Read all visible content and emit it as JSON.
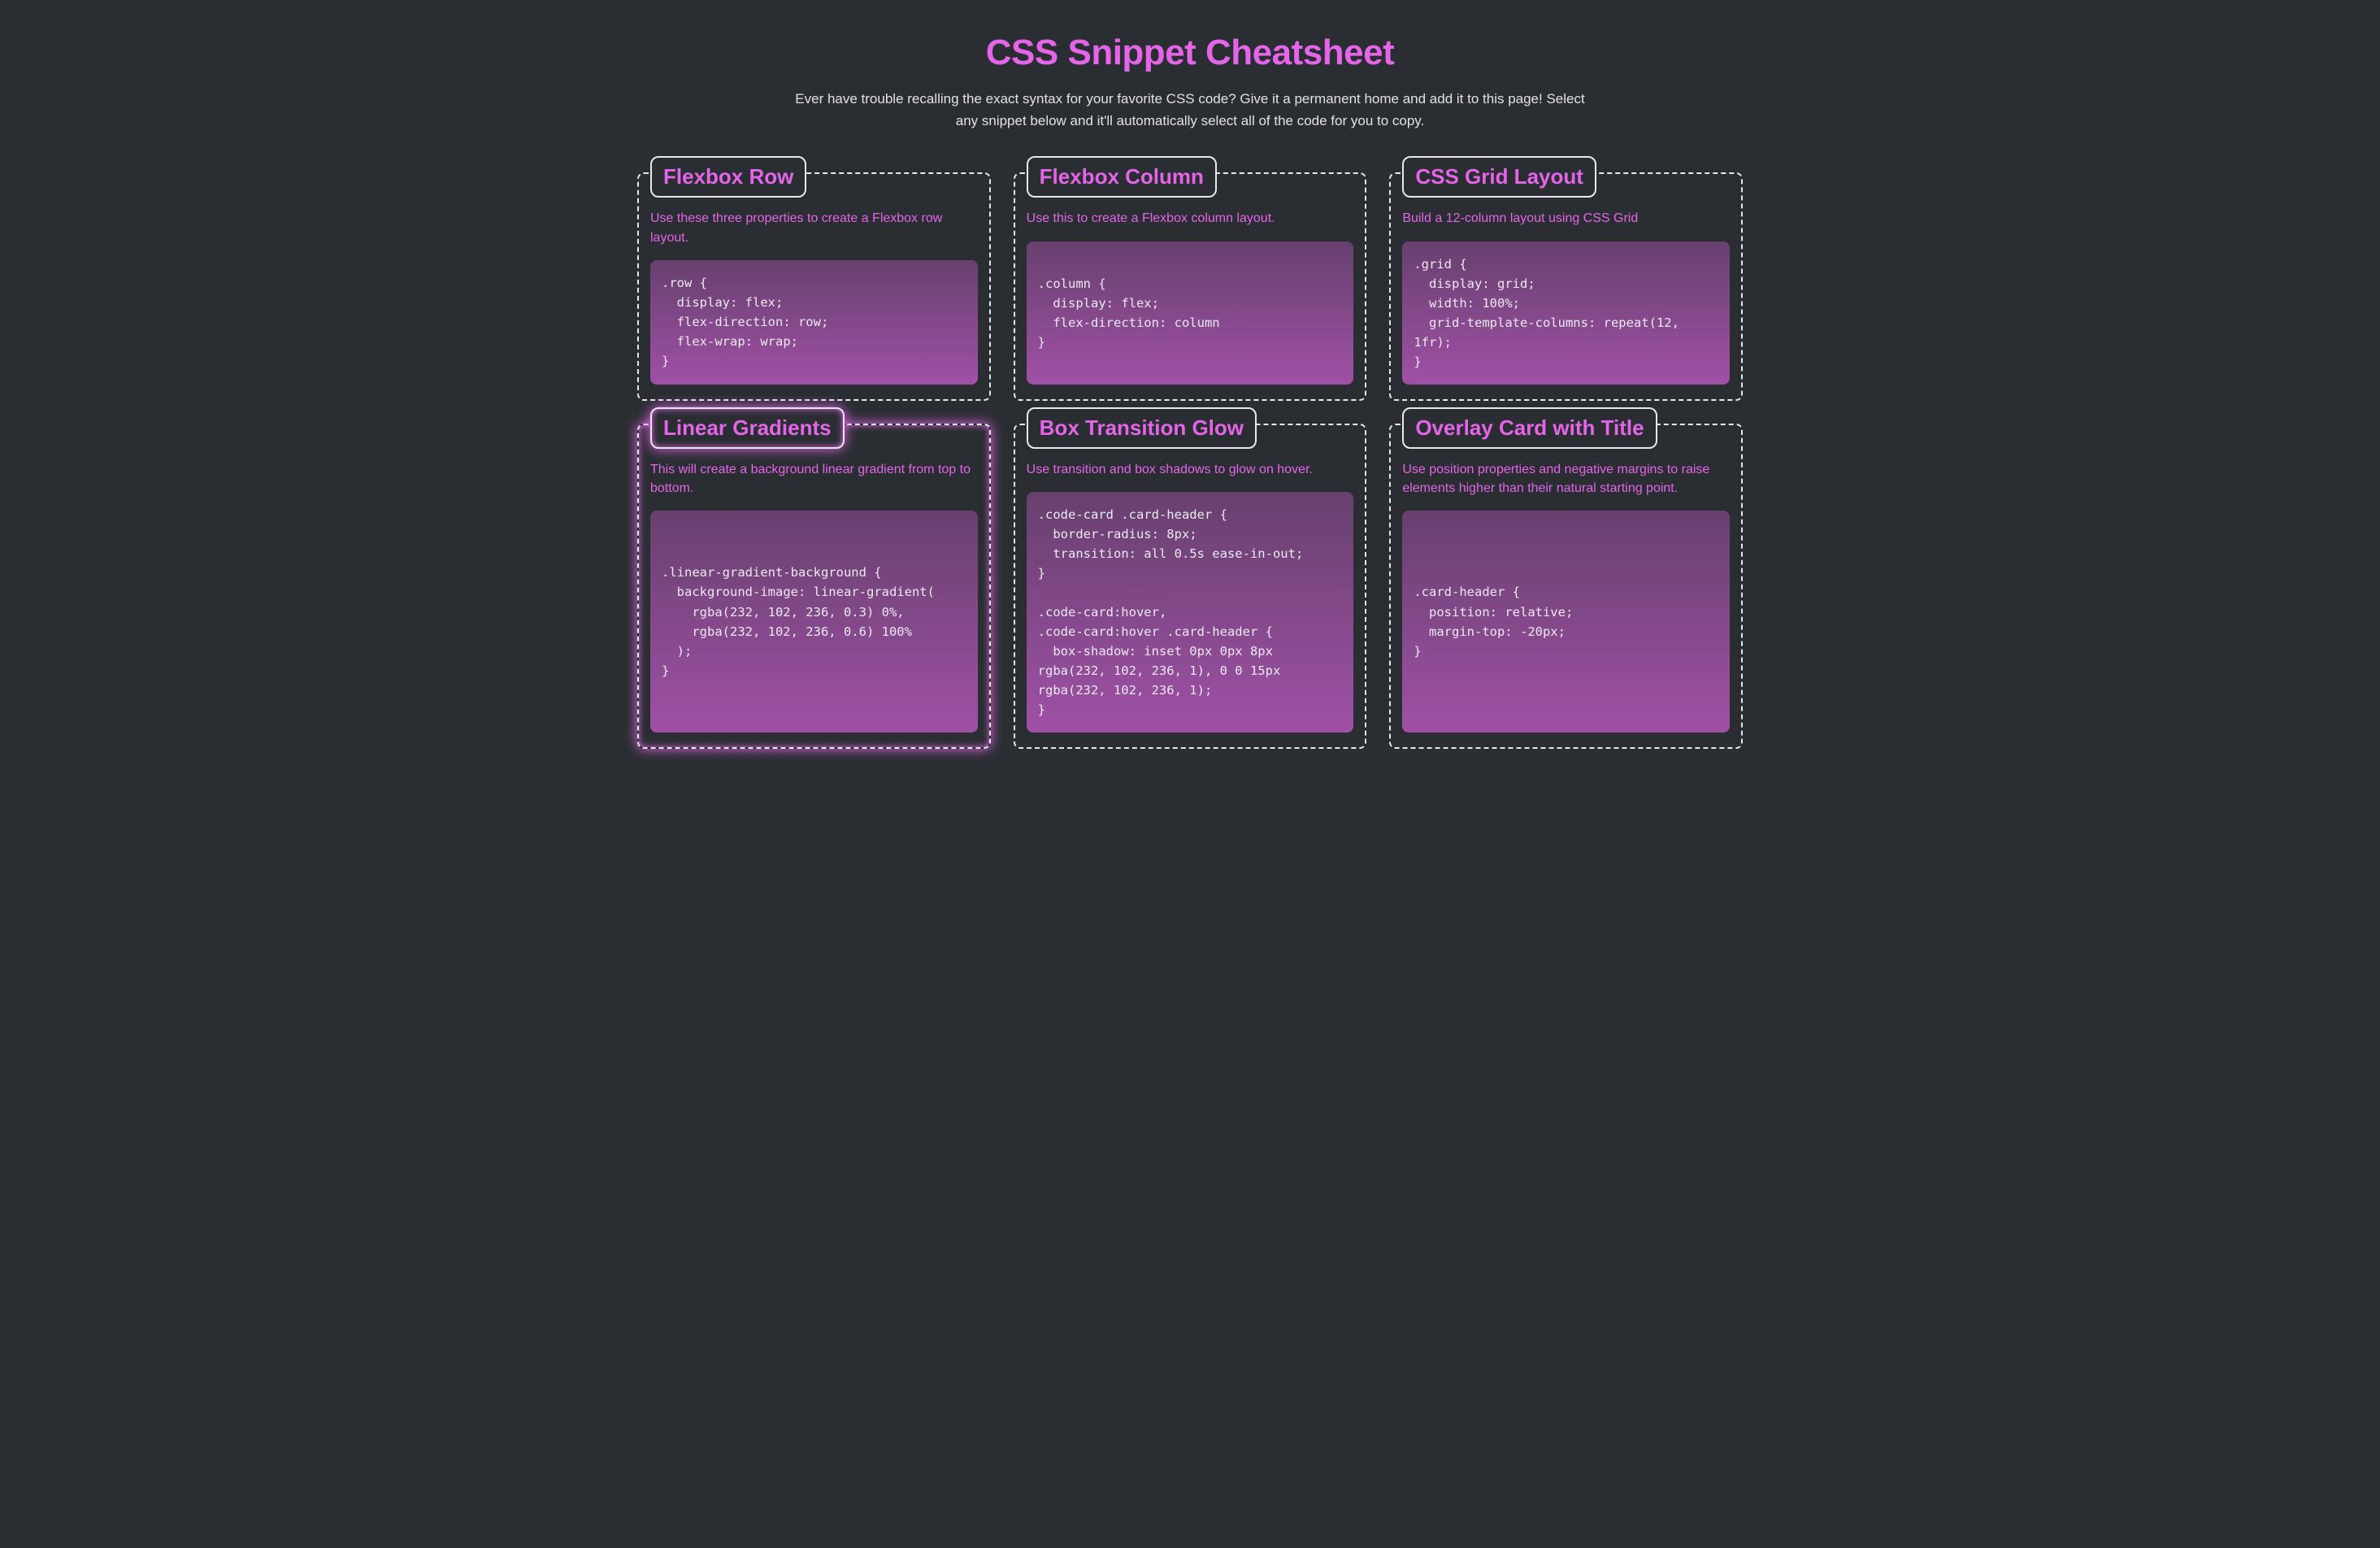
{
  "header": {
    "title": "CSS Snippet Cheatsheet",
    "subtitle": "Ever have trouble recalling the exact syntax for your favorite CSS code? Give it a permanent home and add it to this page! Select any snippet below and it'll automatically select all of the code for you to copy."
  },
  "cards": [
    {
      "title": "Flexbox Row",
      "desc": "Use these three properties to create a Flexbox row layout.",
      "code": ".row {\n  display: flex;\n  flex-direction: row;\n  flex-wrap: wrap;\n}",
      "glow": false
    },
    {
      "title": "Flexbox Column",
      "desc": "Use this to create a Flexbox column layout.",
      "code": ".column {\n  display: flex;\n  flex-direction: column\n}",
      "glow": false
    },
    {
      "title": "CSS Grid Layout",
      "desc": "Build a 12-column layout using CSS Grid",
      "code": ".grid {\n  display: grid;\n  width: 100%;\n  grid-template-columns: repeat(12, 1fr);\n}",
      "glow": false
    },
    {
      "title": "Linear Gradients",
      "desc": "This will create a background linear gradient from top to bottom.",
      "code": ".linear-gradient-background {\n  background-image: linear-gradient(\n    rgba(232, 102, 236, 0.3) 0%,\n    rgba(232, 102, 236, 0.6) 100%\n  );\n}",
      "glow": true
    },
    {
      "title": "Box Transition Glow",
      "desc": "Use transition and box shadows to glow on hover.",
      "code": ".code-card .card-header {\n  border-radius: 8px;\n  transition: all 0.5s ease-in-out;\n}\n\n.code-card:hover,\n.code-card:hover .card-header {\n  box-shadow: inset 0px 0px 8px rgba(232, 102, 236, 1), 0 0 15px rgba(232, 102, 236, 1);\n}",
      "glow": false
    },
    {
      "title": "Overlay Card with Title",
      "desc": "Use position properties and negative margins to raise elements higher than their natural starting point.",
      "code": ".card-header {\n  position: relative;\n  margin-top: -20px;\n}",
      "glow": false
    }
  ]
}
